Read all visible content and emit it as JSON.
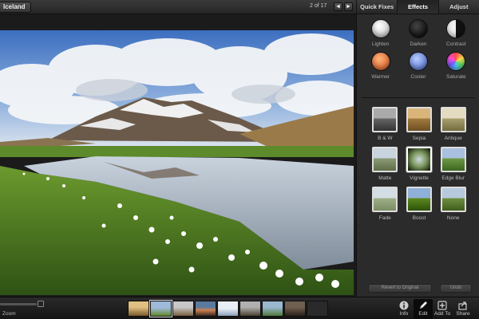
{
  "topbar": {
    "album_label": "Iceland",
    "counter": "2 of 17",
    "prev_glyph": "◄",
    "next_glyph": "►"
  },
  "tabs": [
    {
      "label": "Quick Fixes",
      "active": false
    },
    {
      "label": "Effects",
      "active": true
    },
    {
      "label": "Adjust",
      "active": false
    }
  ],
  "effects": [
    {
      "label": "Lighten",
      "color": "#e8e8e8"
    },
    {
      "label": "Darken",
      "color": "#111111"
    },
    {
      "label": "Contrast",
      "color": "#888888"
    },
    {
      "label": "Warmer",
      "color": "#e8743a"
    },
    {
      "label": "Cooler",
      "color": "#6e8fe0"
    },
    {
      "label": "Saturate",
      "color": "#c24fb0"
    }
  ],
  "filters": [
    {
      "label": "B & W"
    },
    {
      "label": "Sepia"
    },
    {
      "label": "Antique"
    },
    {
      "label": "Matte"
    },
    {
      "label": "Vignette"
    },
    {
      "label": "Edge Blur"
    },
    {
      "label": "Fade"
    },
    {
      "label": "Boost"
    },
    {
      "label": "None"
    }
  ],
  "actions": {
    "revert": "Revert to Original",
    "undo": "Undo"
  },
  "bottombar": {
    "zoom_label": "Zoom",
    "film_count": 9,
    "current_film": 1,
    "tools": {
      "info": "Info",
      "edit": "Edit",
      "add_to": "Add To",
      "share": "Share"
    }
  }
}
